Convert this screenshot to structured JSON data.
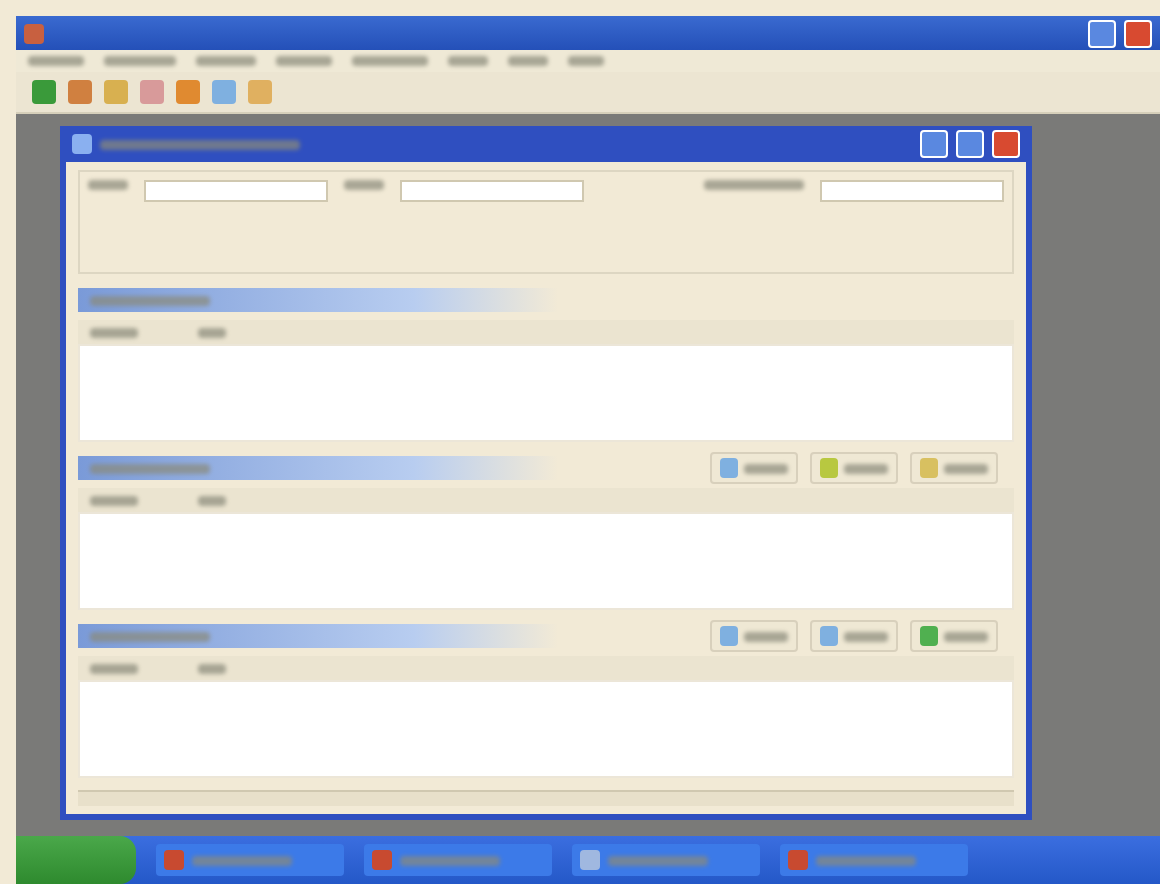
{
  "toolbar": {
    "icons": [
      {
        "color": "#3a9a3a"
      },
      {
        "color": "#d08040"
      },
      {
        "color": "#d8b050"
      },
      {
        "color": "#d89a9a"
      },
      {
        "color": "#e08a30"
      },
      {
        "color": "#7fb0e0"
      },
      {
        "color": "#e0b060"
      }
    ]
  },
  "sections": [
    {
      "buttons": [
        {
          "color": "#7fb0e0"
        },
        {
          "color": "#b8c840"
        },
        {
          "color": "#d8c060"
        }
      ]
    },
    {
      "buttons": [
        {
          "color": "#7fb0e0"
        },
        {
          "color": "#7fb0e0"
        },
        {
          "color": "#50b050"
        }
      ]
    }
  ],
  "taskbar": {
    "items": [
      {
        "color": "#c84a30"
      },
      {
        "color": "#c84a30"
      },
      {
        "color": "#a0b8e0"
      },
      {
        "color": "#c84a30"
      }
    ]
  }
}
